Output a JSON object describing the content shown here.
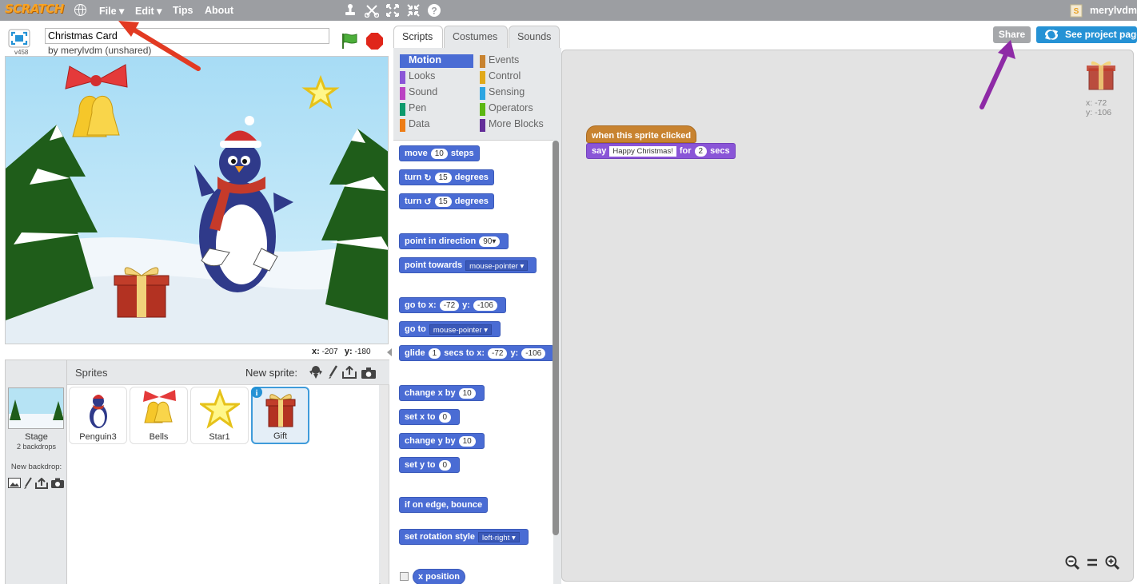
{
  "menubar": {
    "logo": "SCRATCH",
    "file": "File ▾",
    "edit": "Edit ▾",
    "tips": "Tips",
    "about": "About",
    "username": "merylvdm"
  },
  "stage_header": {
    "version": "v458",
    "project_title": "Christmas Card",
    "byline": "by merylvdm (unshared)"
  },
  "stage": {
    "mouse_x_label": "x:",
    "mouse_x": "-207",
    "mouse_y_label": "y:",
    "mouse_y": "-180"
  },
  "sprites_pane": {
    "header": "Sprites",
    "new_sprite_label": "New sprite:",
    "stage_label": "Stage",
    "stage_backdrops": "2 backdrops",
    "new_backdrop_label": "New backdrop:",
    "sprites": [
      {
        "name": "Penguin3"
      },
      {
        "name": "Bells"
      },
      {
        "name": "Star1"
      },
      {
        "name": "Gift",
        "selected": true
      }
    ]
  },
  "tabs": [
    "Scripts",
    "Costumes",
    "Sounds"
  ],
  "categories": [
    {
      "label": "Motion",
      "color": "#4a6cd4",
      "active": true
    },
    {
      "label": "Events",
      "color": "#c88330"
    },
    {
      "label": "Looks",
      "color": "#8a55d7"
    },
    {
      "label": "Control",
      "color": "#e1a91a"
    },
    {
      "label": "Sound",
      "color": "#bb42c3"
    },
    {
      "label": "Sensing",
      "color": "#2ca5e2"
    },
    {
      "label": "Pen",
      "color": "#0e9a6c"
    },
    {
      "label": "Operators",
      "color": "#5cb712"
    },
    {
      "label": "Data",
      "color": "#ee7d16"
    },
    {
      "label": "More Blocks",
      "color": "#632d99"
    }
  ],
  "palette_blocks": {
    "move": {
      "a": "move",
      "v": "10",
      "b": "steps"
    },
    "turn_cw": {
      "a": "turn",
      "v": "15",
      "b": "degrees"
    },
    "turn_ccw": {
      "a": "turn",
      "v": "15",
      "b": "degrees"
    },
    "point_dir": {
      "a": "point in direction",
      "v": "90▾"
    },
    "point_towards": {
      "a": "point towards",
      "v": "mouse-pointer"
    },
    "goto_xy": {
      "a": "go to x:",
      "x": "-72",
      "b": "y:",
      "y": "-106"
    },
    "goto": {
      "a": "go to",
      "v": "mouse-pointer"
    },
    "glide": {
      "a": "glide",
      "s": "1",
      "b": "secs to x:",
      "x": "-72",
      "c": "y:",
      "y": "-106"
    },
    "change_x": {
      "a": "change x by",
      "v": "10"
    },
    "set_x": {
      "a": "set x to",
      "v": "0"
    },
    "change_y": {
      "a": "change y by",
      "v": "10"
    },
    "set_y": {
      "a": "set y to",
      "v": "0"
    },
    "bounce": {
      "a": "if on edge, bounce"
    },
    "rotation": {
      "a": "set rotation style",
      "v": "left-right"
    },
    "x_position": {
      "a": "x position"
    }
  },
  "script": {
    "hat": "when this sprite clicked",
    "say_a": "say",
    "say_text": "Happy Christmas!",
    "say_b": "for",
    "say_secs": "2",
    "say_c": "secs"
  },
  "toolbar_right": {
    "share": "Share",
    "see_project": "See project page"
  },
  "sprite_info": {
    "x_label": "x:",
    "x": "-72",
    "y_label": "y:",
    "y": "-106"
  },
  "colors": {
    "menubar": "#9c9ea2",
    "share_button": "#a5a7aa",
    "see_project_button": "#2592d5",
    "motion": "#4a6cd4",
    "looks": "#8a55d7",
    "events": "#c88330",
    "annotation_red": "#e23a22",
    "annotation_purple": "#8e2aa6"
  }
}
